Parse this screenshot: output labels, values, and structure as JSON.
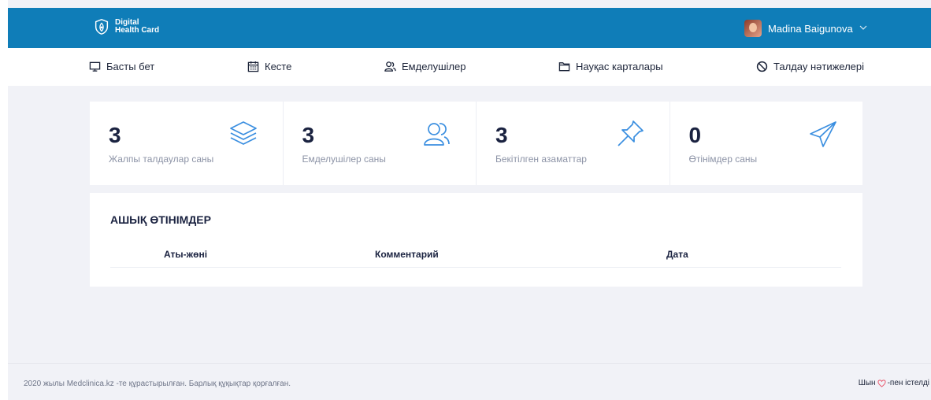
{
  "header": {
    "logo_line1": "Digital",
    "logo_line2": "Health Card",
    "user_name": "Madina Baigunova",
    "accent_color": "#0f7db8"
  },
  "nav": {
    "items": [
      {
        "label": "Басты бет",
        "icon": "monitor-icon"
      },
      {
        "label": "Кесте",
        "icon": "calendar-icon"
      },
      {
        "label": "Емделушілер",
        "icon": "users-icon"
      },
      {
        "label": "Науқас карталары",
        "icon": "folder-icon"
      },
      {
        "label": "Талдау нәтижелері",
        "icon": "ban-icon"
      }
    ]
  },
  "stats": [
    {
      "value": "3",
      "label": "Жалпы талдаулар саны",
      "icon": "layers-icon"
    },
    {
      "value": "3",
      "label": "Емделушілер саны",
      "icon": "users-icon"
    },
    {
      "value": "3",
      "label": "Бекітілген азаматтар",
      "icon": "pin-icon"
    },
    {
      "value": "0",
      "label": "Өтінімдер саны",
      "icon": "send-icon"
    }
  ],
  "requests": {
    "title": "АШЫҚ ӨТІНІМДЕР",
    "columns": [
      "Аты-жөні",
      "Комментарий",
      "Дата"
    ]
  },
  "footer": {
    "copyright": "2020 жылы Medclinica.kz -те құрастырылған. Барлық құқықтар қорғалған.",
    "made_prefix": "Шын",
    "made_suffix": "-пен істелді",
    "heart_color": "#e8576c"
  }
}
